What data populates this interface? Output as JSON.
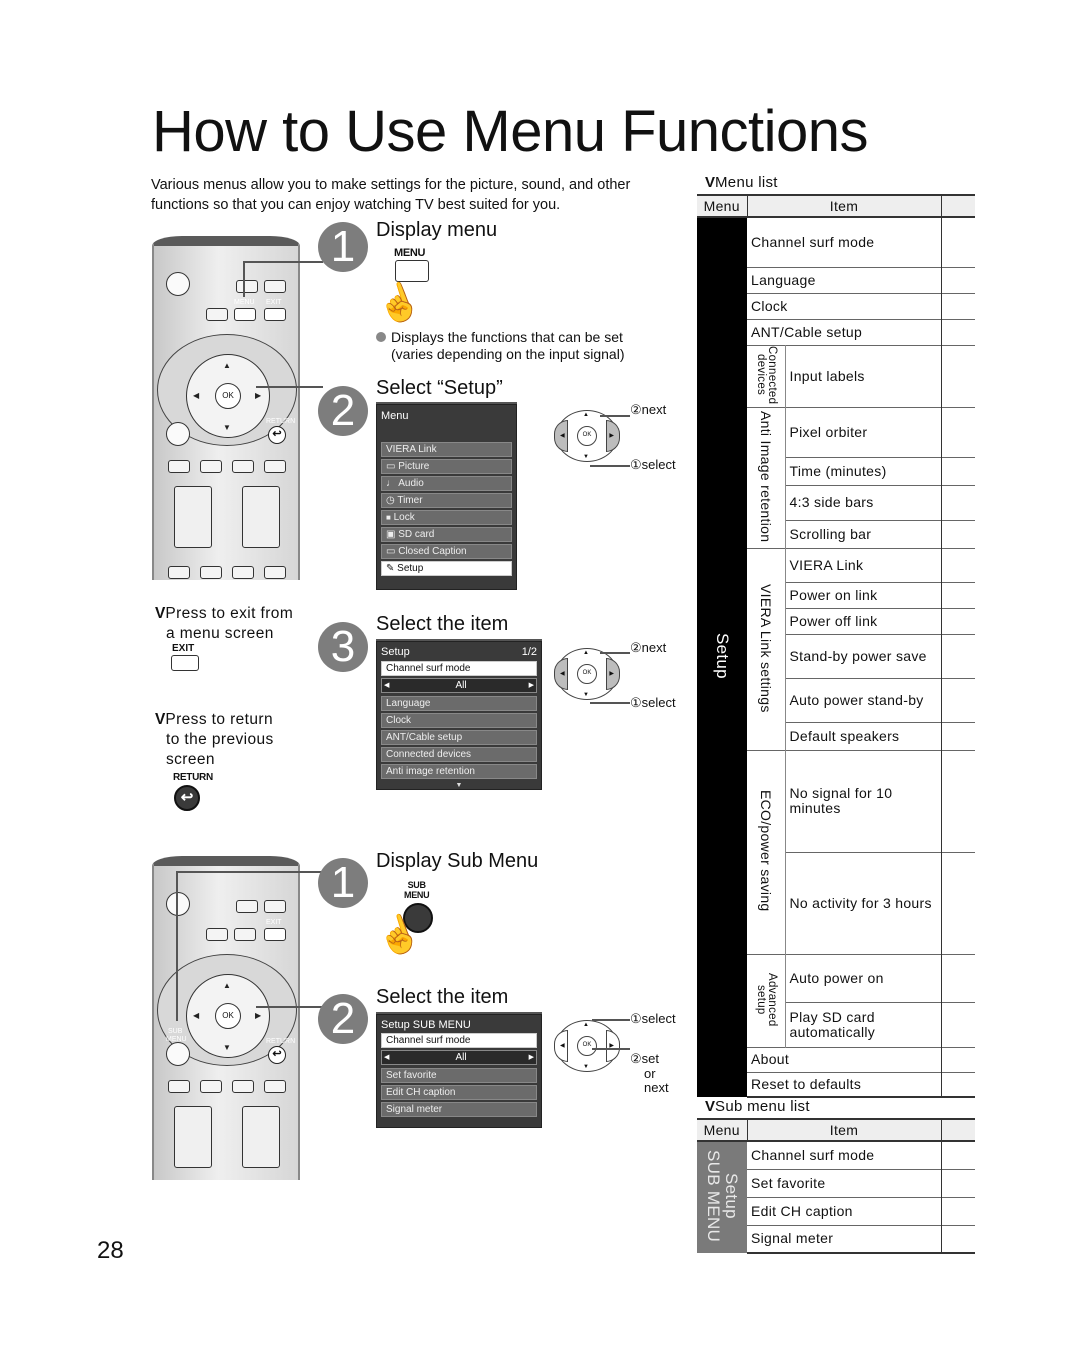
{
  "page": {
    "title": "How to Use Menu Functions",
    "intro": "Various menus allow you to make settings for the picture, sound, and other functions so that you can enjoy watching TV best suited for you.",
    "page_number": "28"
  },
  "remote_labels": {
    "menu": "MENU",
    "exit": "EXIT",
    "ok": "OK",
    "return": "RETURN",
    "sub_menu_line1": "SUB",
    "sub_menu_line2": "MENU"
  },
  "icons": {
    "up_arrow": "▲",
    "down_arrow": "▼",
    "left_arrow": "◀",
    "right_arrow": "▶",
    "return_arrow": "↩",
    "hand": "☝",
    "v_marker": "V"
  },
  "section1": {
    "steps": [
      {
        "number": "1",
        "heading": "Display menu",
        "key_label": "MENU",
        "bullet": [
          "Displays the functions that can be set",
          "(varies depending on the input signal)"
        ]
      },
      {
        "number": "2",
        "heading": "Select “Setup”"
      },
      {
        "number": "3",
        "heading": "Select the item"
      }
    ],
    "main_menu": {
      "title": "Menu",
      "items": [
        {
          "icon": "viera-link-icon",
          "label": "VIERA Link",
          "glyph": ""
        },
        {
          "icon": "picture-icon",
          "label": "Picture",
          "glyph": "▭"
        },
        {
          "icon": "audio-icon",
          "label": "Audio",
          "glyph": "♩"
        },
        {
          "icon": "timer-icon",
          "label": "Timer",
          "glyph": "◷"
        },
        {
          "icon": "lock-icon",
          "label": "Lock",
          "glyph": "🔒"
        },
        {
          "icon": "sd-card-icon",
          "label": "SD card",
          "glyph": "▣"
        },
        {
          "icon": "closed-caption-icon",
          "label": "Closed Caption",
          "glyph": "▭"
        },
        {
          "icon": "setup-icon",
          "label": "Setup",
          "glyph": "✎",
          "selected": true
        }
      ]
    },
    "setup_menu": {
      "title": "Setup",
      "page": "1/2",
      "selected_item": "Channel surf mode",
      "selected_value": "All",
      "items": [
        "Language",
        "Clock",
        "ANT/Cable setup",
        "Connected devices",
        "Anti image retention"
      ]
    },
    "nav_annotations": {
      "next": "②next",
      "select": "①select"
    },
    "notes": {
      "exit": {
        "line1": "Press to exit from",
        "line2": "a menu screen",
        "key": "EXIT"
      },
      "return": {
        "line1": "Press to return",
        "line2": "to the previous",
        "line3": "screen",
        "key": "RETURN"
      }
    }
  },
  "section2": {
    "steps": [
      {
        "number": "1",
        "heading": "Display Sub Menu"
      },
      {
        "number": "2",
        "heading": "Select the item"
      }
    ],
    "sub_menu": {
      "title": "Setup SUB MENU",
      "selected_item": "Channel surf mode",
      "selected_value": "All",
      "items": [
        "Set favorite",
        "Edit CH caption",
        "Signal meter"
      ]
    },
    "nav_annotations": {
      "select": "①select",
      "set": "②set",
      "or": "or",
      "next": "next"
    }
  },
  "menu_list": {
    "caption": "Menu list",
    "headers": {
      "menu": "Menu",
      "item": "Item"
    },
    "menu_name": "Setup",
    "rows": [
      {
        "group": "",
        "item": "Channel surf mode"
      },
      {
        "group": "",
        "item": "Language"
      },
      {
        "group": "",
        "item": "Clock"
      },
      {
        "group": "",
        "item": "ANT/Cable setup"
      },
      {
        "group": "Connected devices",
        "item": "Input labels"
      },
      {
        "group": "Anti Image retention",
        "item": "Pixel orbiter"
      },
      {
        "group": "Anti Image retention",
        "item": "Time (minutes)"
      },
      {
        "group": "Anti Image retention",
        "item": "4:3 side bars"
      },
      {
        "group": "Anti Image retention",
        "item": "Scrolling bar"
      },
      {
        "group": "VIERA Link settings",
        "item": "VIERA Link"
      },
      {
        "group": "VIERA Link settings",
        "item": "Power on link"
      },
      {
        "group": "VIERA Link settings",
        "item": "Power off link"
      },
      {
        "group": "VIERA Link settings",
        "item": "Stand-by power save"
      },
      {
        "group": "VIERA Link settings",
        "item": "Auto power stand-by"
      },
      {
        "group": "VIERA Link settings",
        "item": "Default speakers"
      },
      {
        "group": "ECO/power saving",
        "item": "No signal for 10 minutes"
      },
      {
        "group": "ECO/power saving",
        "item": "No activity for 3 hours"
      },
      {
        "group": "Advanced setup",
        "item": "Auto power on"
      },
      {
        "group": "Advanced setup",
        "item": "Play SD card automatically"
      },
      {
        "group": "",
        "item": "About"
      },
      {
        "group": "",
        "item": "Reset to defaults"
      }
    ],
    "group_labels": {
      "connected_line1": "Connected",
      "connected_line2": "devices",
      "anti_image": "Anti Image retention",
      "viera_link": "VIERA Link settings",
      "eco": "ECO/power saving",
      "advanced_line1": "Advanced",
      "advanced_line2": "setup"
    }
  },
  "sub_menu_list": {
    "caption": "Sub menu list",
    "headers": {
      "menu": "Menu",
      "item": "Item"
    },
    "menu_name_line1": "Setup",
    "menu_name_line2": "SUB MENU",
    "rows": [
      "Channel surf mode",
      "Set favorite",
      "Edit CH caption",
      "Signal meter"
    ]
  }
}
